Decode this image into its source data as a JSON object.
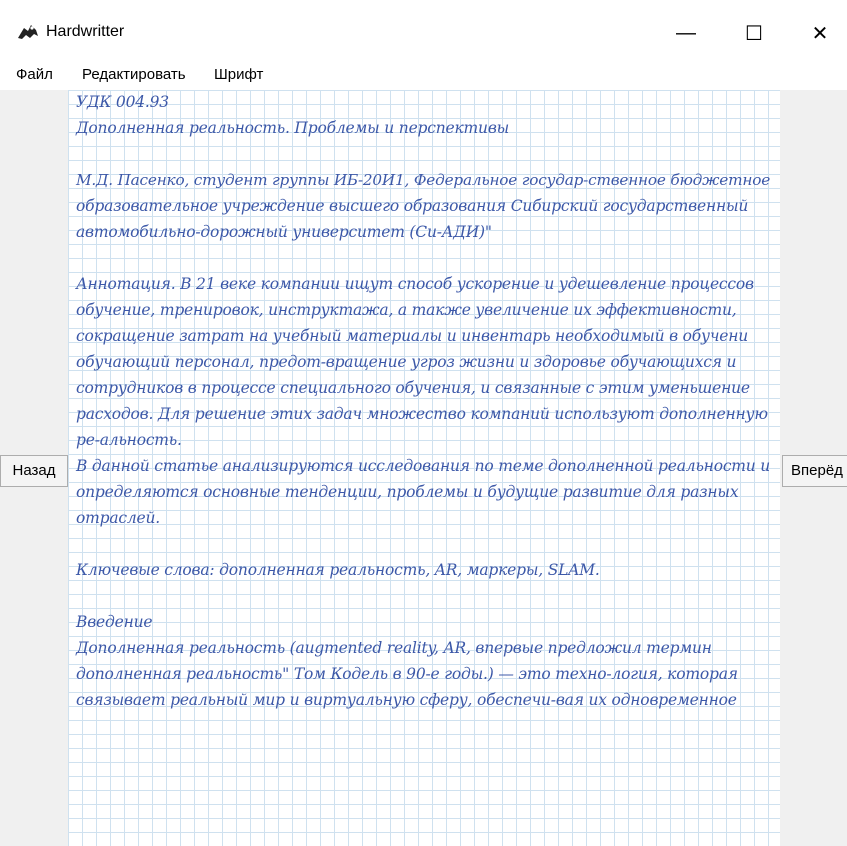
{
  "window": {
    "title": "Hardwritter",
    "minimize_glyph": "—",
    "maximize_glyph": "☐",
    "close_glyph": "✕"
  },
  "menu": [
    "Файл",
    "Редактировать",
    "Шрифт"
  ],
  "nav": {
    "back": "Назад",
    "forward": "Вперёд"
  },
  "document": {
    "lines": [
      "УДК 004.93",
      "Дополненная реальность. Проблемы и перспективы",
      "",
      "М.Д. Пасенко, студент группы ИБ-20И1, Федеральное государ-ственное бюджетное",
      "образовательное учреждение высшего образования Сибирский государственный",
      "автомобильно-дорожный университет (Си-АДИ)\"",
      "",
      "Аннотация. В 21 веке компании ищут способ ускорение и удешевление процессов",
      "обучение, тренировок, инструктажа, а также увеличение их эффективности,",
      "сокращение затрат на учебный материалы и инвентарь необходимый в обучени",
      "обучающий персонал, предот-вращение угроз жизни и здоровье обучающихся и",
      "сотрудников в процессе специального обучения, и связанные с этим уменьшение",
      "расходов. Для решение этих задач множество компаний используют дополненную",
      "ре-альность.",
      "В данной статье анализируются исследования по теме дополненной реальности и",
      "определяются основные тенденции, проблемы и будущие развитие для разных",
      "отраслей.",
      "",
      "Ключевые слова: дополненная реальность, AR, маркеры, SLAM.",
      "",
      "Введение",
      "Дополненная реальность (augmented reality, AR, впервые предложил термин",
      "дополненная реальность\" Том Кодель в 90-е годы.) — это техно-логия, которая",
      "связывает реальный мир и виртуальную сферу, обеспечи-вая их одновременное"
    ]
  }
}
